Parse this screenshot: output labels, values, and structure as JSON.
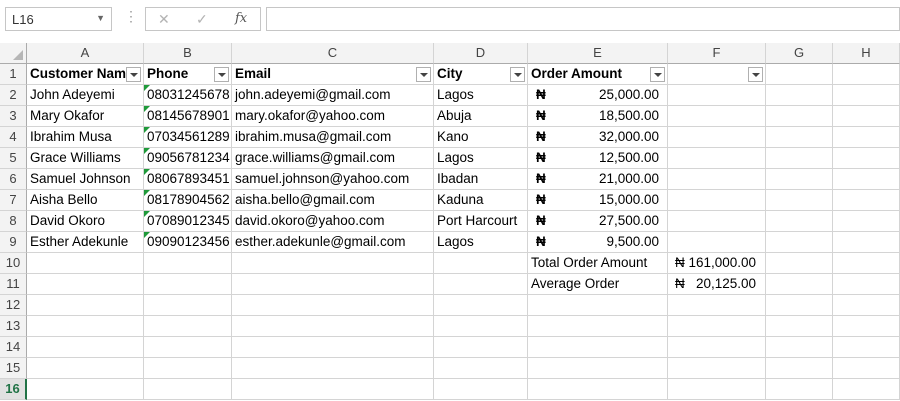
{
  "formula_bar": {
    "name_box": "L16",
    "cancel_icon": "✕",
    "enter_icon": "✓",
    "fx_label": "fx",
    "formula": ""
  },
  "columns": [
    "A",
    "B",
    "C",
    "D",
    "E",
    "F",
    "G",
    "H"
  ],
  "rows": [
    "1",
    "2",
    "3",
    "4",
    "5",
    "6",
    "7",
    "8",
    "9",
    "10",
    "11",
    "12",
    "13",
    "14",
    "15",
    "16"
  ],
  "selected_row": "16",
  "headers": {
    "customer_name": "Customer Nam",
    "phone": "Phone",
    "email": "Email",
    "city": "City",
    "order_amount": "Order Amount"
  },
  "currency_symbol": "₦",
  "customers": [
    {
      "name": "John Adeyemi",
      "phone": "08031245678",
      "email": "john.adeyemi@gmail.com",
      "city": "Lagos",
      "amount": "25,000.00"
    },
    {
      "name": "Mary Okafor",
      "phone": "08145678901",
      "email": "mary.okafor@yahoo.com",
      "city": "Abuja",
      "amount": "18,500.00"
    },
    {
      "name": "Ibrahim Musa",
      "phone": "07034561289",
      "email": "ibrahim.musa@gmail.com",
      "city": "Kano",
      "amount": "32,000.00"
    },
    {
      "name": "Grace Williams",
      "phone": "09056781234",
      "email": "grace.williams@gmail.com",
      "city": "Lagos",
      "amount": "12,500.00"
    },
    {
      "name": "Samuel Johnson",
      "phone": "08067893451",
      "email": "samuel.johnson@yahoo.com",
      "city": "Ibadan",
      "amount": "21,000.00"
    },
    {
      "name": "Aisha Bello",
      "phone": "08178904562",
      "email": "aisha.bello@gmail.com",
      "city": "Kaduna",
      "amount": "15,000.00"
    },
    {
      "name": "David Okoro",
      "phone": "07089012345",
      "email": "david.okoro@yahoo.com",
      "city": "Port Harcourt",
      "amount": "27,500.00"
    },
    {
      "name": "Esther Adekunle",
      "phone": "09090123456",
      "email": "esther.adekunle@gmail.com",
      "city": "Lagos",
      "amount": "9,500.00"
    }
  ],
  "summary": {
    "total_label": "Total Order Amount",
    "total_value": "₦ 161,000.00",
    "average_label": "Average Order",
    "average_value": "₦   20,125.00"
  },
  "colors": {
    "accent": "#217346",
    "green_triangle": "#1f9a3a"
  }
}
